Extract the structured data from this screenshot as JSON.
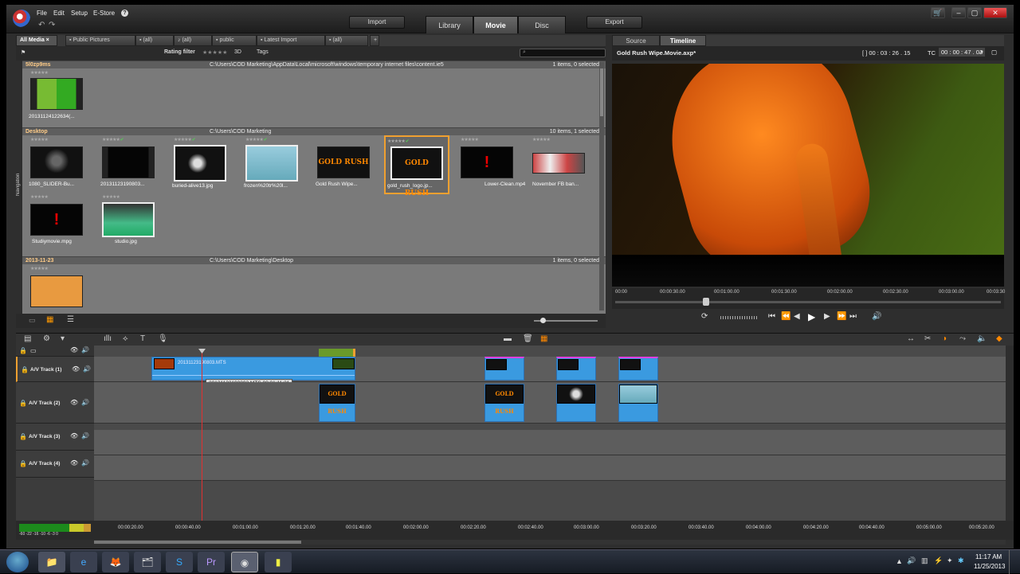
{
  "menu": {
    "file": "File",
    "edit": "Edit",
    "setup": "Setup",
    "estore": "E-Store",
    "help": "?"
  },
  "top": {
    "import": "Import",
    "export": "Export",
    "tabs": [
      "Library",
      "Movie",
      "Disc"
    ],
    "selected_tab": "Movie"
  },
  "library": {
    "tabs": [
      "All Media",
      "Public Pictures",
      "(all)",
      "(all)",
      "public",
      "Latest Import",
      "(all)"
    ],
    "rating_filter": "Rating filter",
    "rating_stars": "★★★★★",
    "three_d": "3D",
    "tags": "Tags",
    "groups": [
      {
        "name": "5l0zp9ms",
        "path": "C:\\Users\\COD Marketing\\AppData\\Local\\microsoft\\windows\\temporary internet files\\content.ie5",
        "count": "1 items, 0 selected"
      },
      {
        "name": "Desktop",
        "path": "C:\\Users\\COD Marketing",
        "count": "10 items, 1 selected"
      },
      {
        "name": "2013-11-23",
        "path": "C:\\Users\\COD Marketing\\Desktop",
        "count": "1 items, 0 selected"
      }
    ],
    "items_group1": [
      "20131124122634(..."
    ],
    "items_group2": [
      "1080_SLIDER-Bu...",
      "20131123190803...",
      "buried-alive13.jpg",
      "frozen%20tr%20l...",
      "Gold Rush Wipe...",
      "gold_rush_logo.jp...",
      "Lower-Clean.mp4",
      "November FB ban..."
    ],
    "items_group2b": [
      "Studiymovie.mpg",
      "studio.jpg"
    ],
    "navigation": "Navigation"
  },
  "player": {
    "source_tab": "Source",
    "timeline_tab": "Timeline",
    "title": "Gold Rush Wipe.Movie.axp*",
    "duration": "[ ] 00 : 03 : 26 . 15",
    "tc_label": "TC",
    "timecode": "00 : 00 : 47 . 03",
    "scrub_ticks": [
      "00:00",
      "00:00:30.00",
      "00:01:00.00",
      "00:01:30.00",
      "00:02:00.00",
      "00:02:30.00",
      "00:03:00.00",
      "00:03:30"
    ]
  },
  "timeline": {
    "tracks": [
      "A/V Track (1)",
      "A/V Track (2)",
      "A/V Track (3)",
      "A/V Track (4)"
    ],
    "clip_label": "20131123190803.MTS",
    "tooltip": "20131123190803.MTS  00:01:11:21",
    "gold_rush_text": "GOLD RUSH",
    "ruler": [
      "00:00:20.00",
      "00:00:40.00",
      "00:01:00.00",
      "00:01:20.00",
      "00:01:40.00",
      "00:02:00.00",
      "00:02:20.00",
      "00:02:40.00",
      "00:03:00.00",
      "00:03:20.00",
      "00:03:40.00",
      "00:04:00.00",
      "00:04:20.00",
      "00:04:40.00",
      "00:05:00.00",
      "00:05:20.00"
    ],
    "meter_labels": "-60 -22 -16 -10 -6 -3 0"
  },
  "taskbar": {
    "time": "11:17 AM",
    "date": "11/25/2013"
  },
  "colors": {
    "accent": "#f0a030",
    "clip": "#3a9ae0",
    "playhead": "#e03030"
  }
}
